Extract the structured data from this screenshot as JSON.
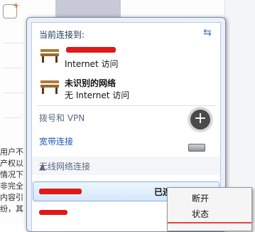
{
  "background": {
    "snippets": [
      "用户不",
      "产权以",
      "情况下",
      "非完全",
      "内容引",
      "纷，其"
    ]
  },
  "flyout": {
    "current_header": "当前连接到:",
    "connections": [
      {
        "name": "",
        "status": "Internet 访问"
      },
      {
        "name": "未识别的网络",
        "status": "无 Internet 访问"
      }
    ],
    "dialup_header": "拨号和 VPN",
    "broadband_link": "宽带连接",
    "wireless_header": "无线网络连接",
    "wifi_state": "已连接"
  },
  "context_menu": {
    "items": [
      "断开",
      "状态"
    ]
  },
  "colors": {
    "redaction": "#e0191b",
    "signal": "#2f9b2f",
    "link": "#1a56b8"
  }
}
